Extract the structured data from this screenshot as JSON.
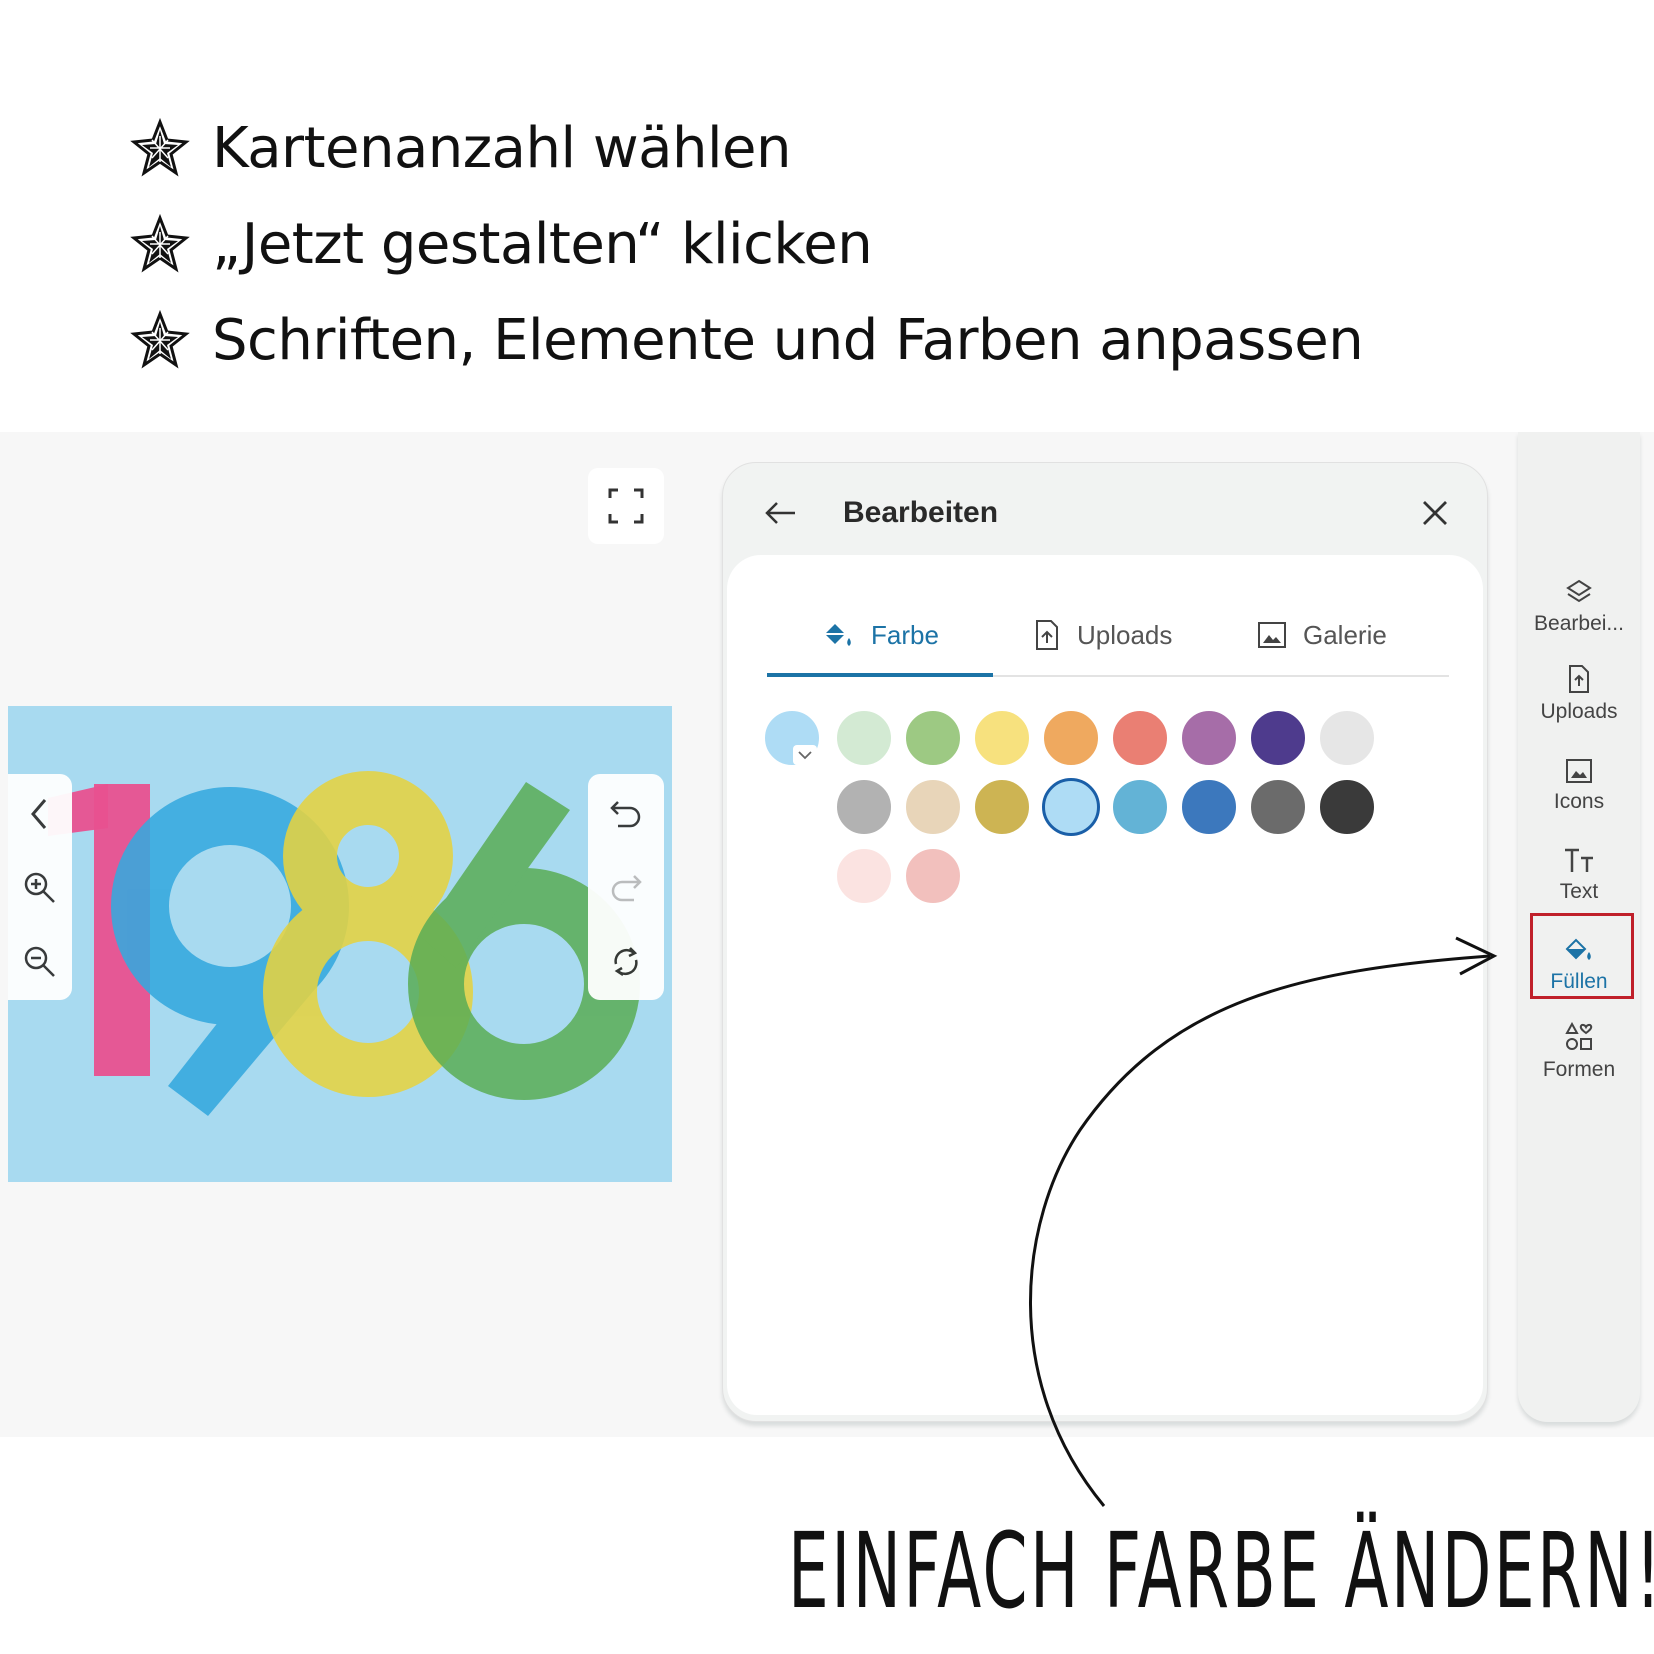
{
  "instructions": [
    {
      "text": "Kartenanzahl wählen"
    },
    {
      "text": "„Jetzt gestalten“ klicken"
    },
    {
      "text": "Schriften, Elemente und Farben anpassen"
    }
  ],
  "card": {
    "year": "1986",
    "background": "#a8daf0",
    "digit_colors": [
      "#e8518f",
      "#35a8de",
      "#e5d341",
      "#5aad55"
    ]
  },
  "panel": {
    "title": "Bearbeiten",
    "tabs": [
      {
        "label": "Farbe",
        "icon": "paint-bucket-icon",
        "active": true
      },
      {
        "label": "Uploads",
        "icon": "upload-file-icon",
        "active": false
      },
      {
        "label": "Galerie",
        "icon": "image-icon",
        "active": false
      }
    ],
    "swatches": [
      {
        "color": "#aedcf5",
        "current": true
      },
      {
        "color": "#d3ead3"
      },
      {
        "color": "#9dc983"
      },
      {
        "color": "#f7e17e"
      },
      {
        "color": "#efa95f"
      },
      {
        "color": "#ea7f73"
      },
      {
        "color": "#a66da8"
      },
      {
        "color": "#4e3b8d"
      },
      {
        "color": "#e6e6e6"
      },
      {
        "color": "#b2b2b2"
      },
      {
        "color": "#e8d5b9"
      },
      {
        "color": "#cdb453"
      },
      {
        "color": "#aedcf5",
        "selected": true
      },
      {
        "color": "#63b3d6"
      },
      {
        "color": "#3c78bd"
      },
      {
        "color": "#6b6b6b"
      },
      {
        "color": "#3a3a3a"
      },
      {
        "color": "#fbe3e1"
      },
      {
        "color": "#f2c0bd"
      }
    ]
  },
  "sidebar": {
    "items": [
      {
        "label": "Bearbei...",
        "icon": "layers-icon"
      },
      {
        "label": "Uploads",
        "icon": "upload-file-icon"
      },
      {
        "label": "Icons",
        "icon": "image-icon"
      },
      {
        "label": "Text",
        "icon": "text-size-icon"
      },
      {
        "label": "Füllen",
        "icon": "paint-bucket-icon",
        "active": true
      },
      {
        "label": "Formen",
        "icon": "shapes-icon"
      }
    ]
  },
  "annotation": {
    "text": "EINFACH FARBE ÄNDERN!"
  },
  "colors": {
    "accent": "#1c73a6",
    "highlight": "#c0202a"
  }
}
